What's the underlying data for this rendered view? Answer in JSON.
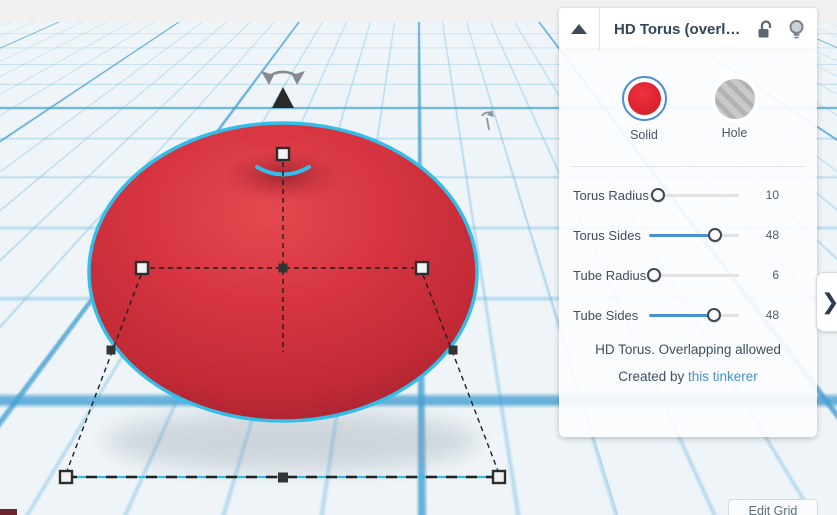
{
  "panel": {
    "header": {
      "title": "HD Torus (overl…",
      "collapse_icon": "triangle-up",
      "lock_icon": "unlocked-padlock",
      "bulb_icon": "lightbulb"
    },
    "material": {
      "solid_label": "Solid",
      "hole_label": "Hole",
      "selected": "Solid"
    },
    "sliders": [
      {
        "label": "Torus Radius",
        "value": "10",
        "pct": 10,
        "filled": false
      },
      {
        "label": "Torus Sides",
        "value": "48",
        "pct": 73,
        "filled": true
      },
      {
        "label": "Tube Radius",
        "value": "6",
        "pct": 6,
        "filled": false
      },
      {
        "label": "Tube Sides",
        "value": "48",
        "pct": 72,
        "filled": true
      }
    ],
    "description": {
      "line1": "HD Torus. Overlapping allowed",
      "line2_prefix": "Created by ",
      "link_text": "this tinkerer"
    }
  },
  "panel_toggle": {
    "glyph": "❯"
  },
  "canvas": {
    "edit_grid_label": "Edit Grid",
    "selected_shape": "HD Torus"
  },
  "colors": {
    "shape_red": "#d63540",
    "selection_cyan": "#35bde9",
    "accent_blue": "#4a90d9",
    "link_blue": "#4a90c9",
    "grid_blue": "#6eb4dc",
    "text_slate": "#3e4f61"
  }
}
